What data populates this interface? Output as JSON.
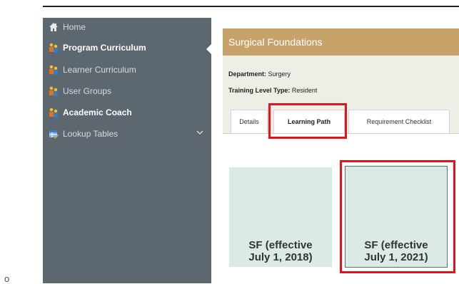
{
  "sidebar": {
    "items": [
      {
        "label": "Home",
        "icon": "home-icon",
        "active": false
      },
      {
        "label": "Program Curriculum",
        "icon": "people-icon",
        "active": true
      },
      {
        "label": "Learner Curriculum",
        "icon": "people-icon",
        "active": false
      },
      {
        "label": "User Groups",
        "icon": "people-icon",
        "active": false
      },
      {
        "label": "Academic Coach",
        "icon": "people-icon",
        "active": true
      },
      {
        "label": "Lookup Tables",
        "icon": "table-edit-icon",
        "active": false,
        "expandable": true
      }
    ]
  },
  "panel": {
    "title": "Surgical Foundations",
    "department_label": "Department:",
    "department_value": "Surgery",
    "training_label": "Training Level Type:",
    "training_value": "Resident"
  },
  "tabs": [
    {
      "label": "Details",
      "active": false
    },
    {
      "label": "Learning Path",
      "active": true
    },
    {
      "label": "Requirement Checklist",
      "active": false
    }
  ],
  "cards": [
    {
      "line1": "SF (effective",
      "line2": "July 1, 2018)"
    },
    {
      "line1": "SF (effective",
      "line2": "July 1, 2021)"
    }
  ],
  "bullet": "o",
  "colors": {
    "sidebar": "#5d6770",
    "header": "#c7a36a",
    "panel_body": "#eeeee6",
    "card": "#dbe9e7",
    "highlight": "#e3141b"
  }
}
